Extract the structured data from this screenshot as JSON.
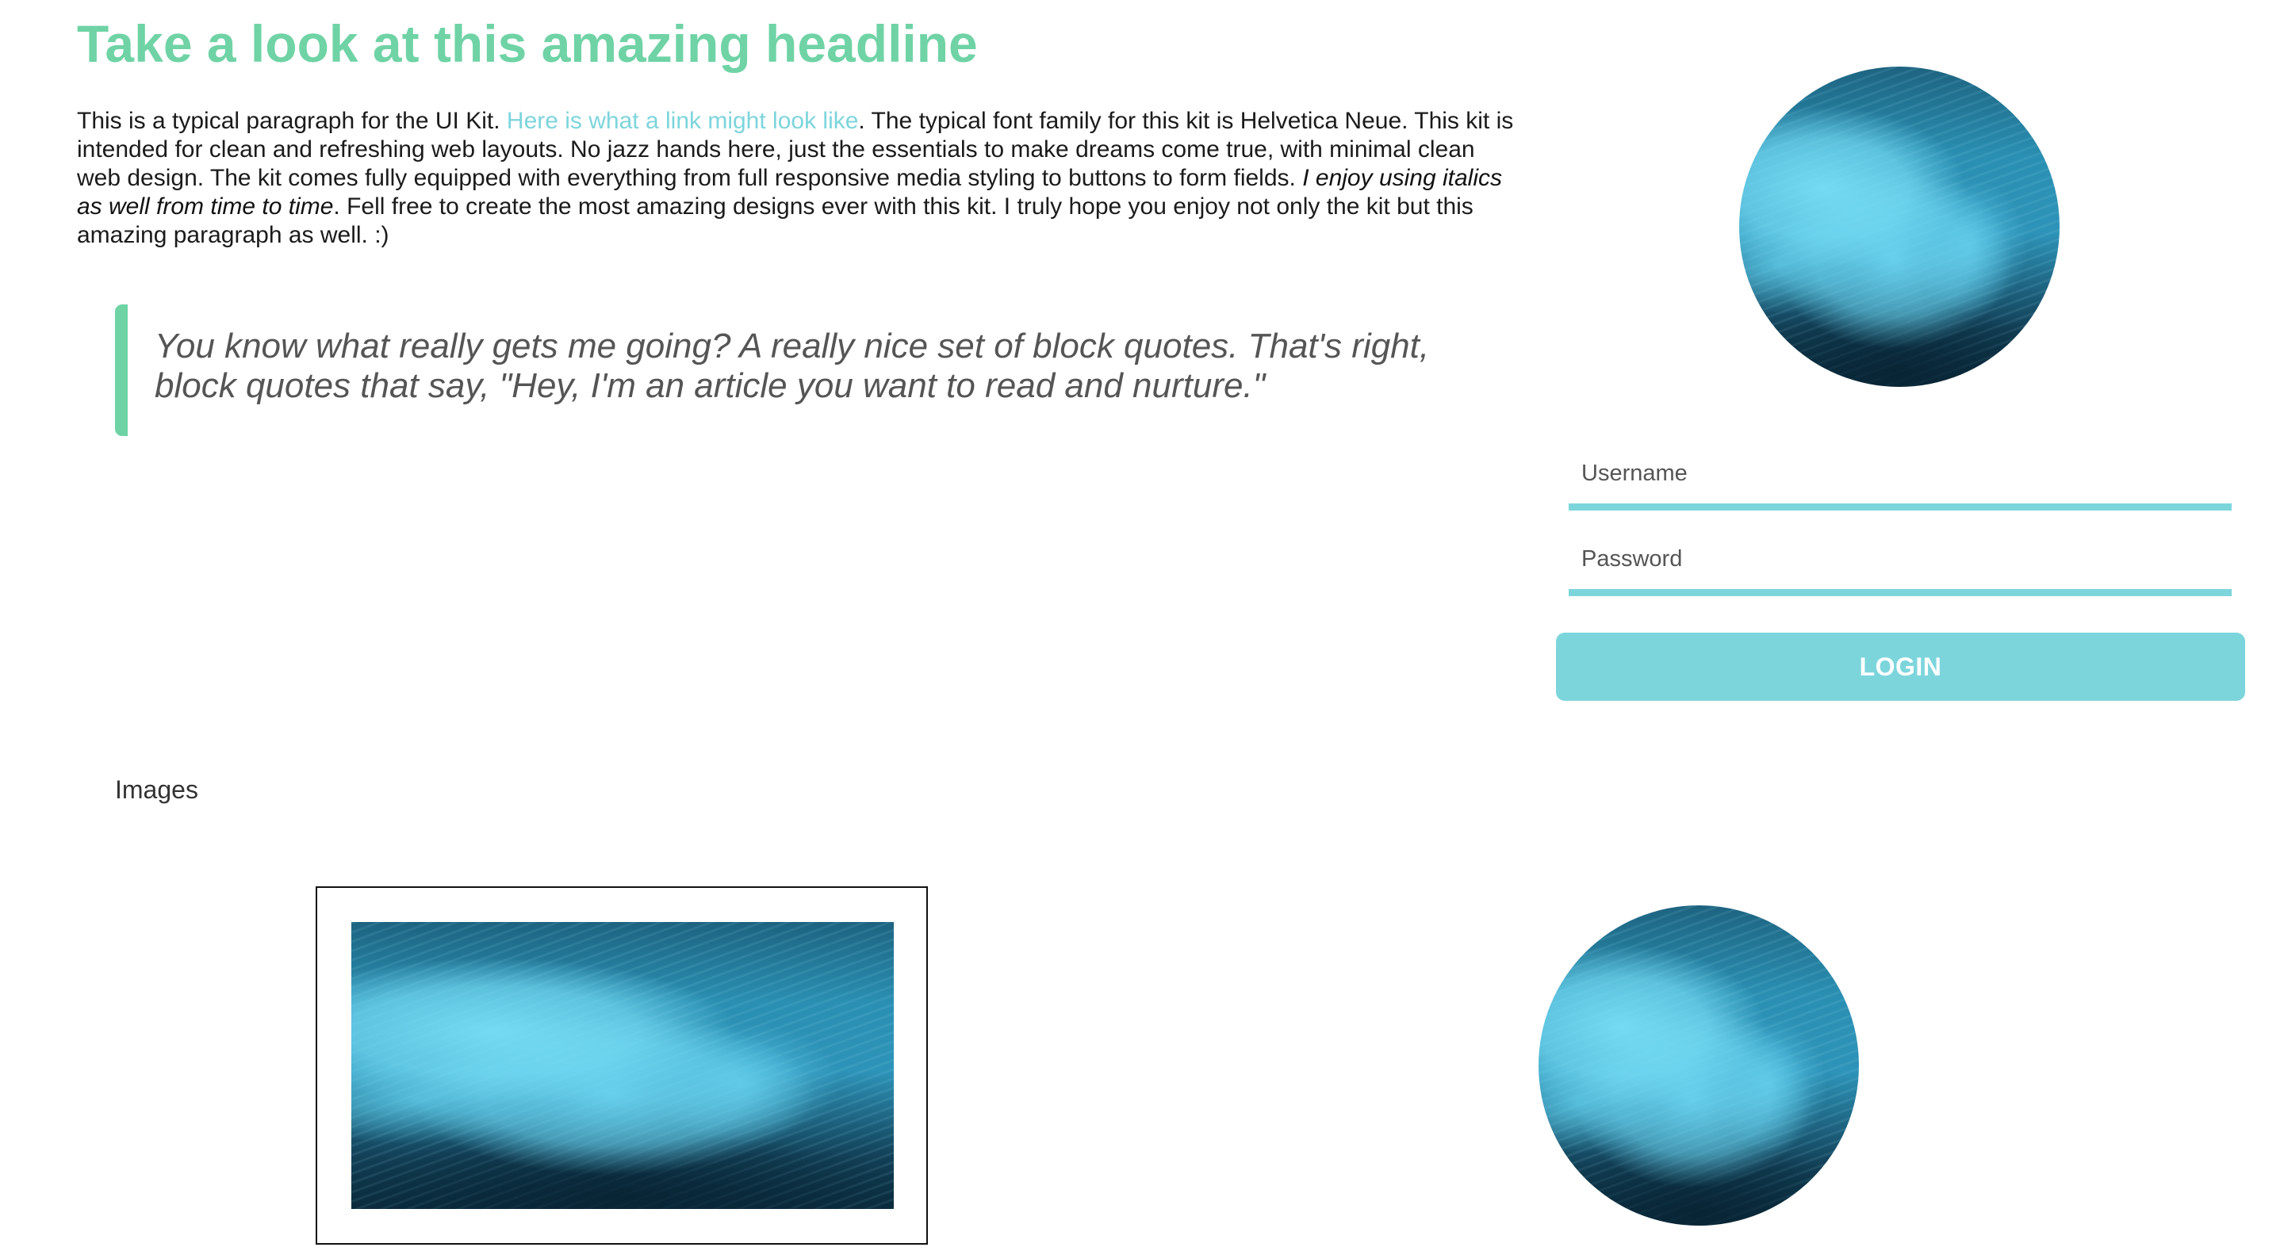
{
  "headline": "Take a look at this amazing headline",
  "paragraph": {
    "text_before_link": "This is a typical paragraph for the UI Kit. ",
    "link_text": "Here is what a link might look like",
    "text_after_link": ". The typical font family for this kit is Helvetica Neue. This kit is intended for clean and refreshing web layouts. No jazz hands here, just the essentials to make dreams come true, with minimal clean web design. The kit comes fully equipped with everything from full responsive media styling to buttons to form fields. ",
    "italic_text": "I enjoy using italics as well from time to time",
    "text_after_italic": ". Fell free to create the most amazing designs ever with this kit. I truly hope you enjoy not only the kit but this amazing paragraph as well. :)"
  },
  "blockquote": "You know what really gets me going? A really nice set of block quotes. That's right, block quotes that say, \"Hey, I'm an article you want to read and nurture.\"",
  "login": {
    "username_placeholder": "Username",
    "password_placeholder": "Password",
    "button_label": "LOGIN"
  },
  "images_section": {
    "label": "Images"
  },
  "colors": {
    "headline_green": "#6fd3a5",
    "accent_teal": "#7dd5dc",
    "quote_gray": "#555555"
  }
}
